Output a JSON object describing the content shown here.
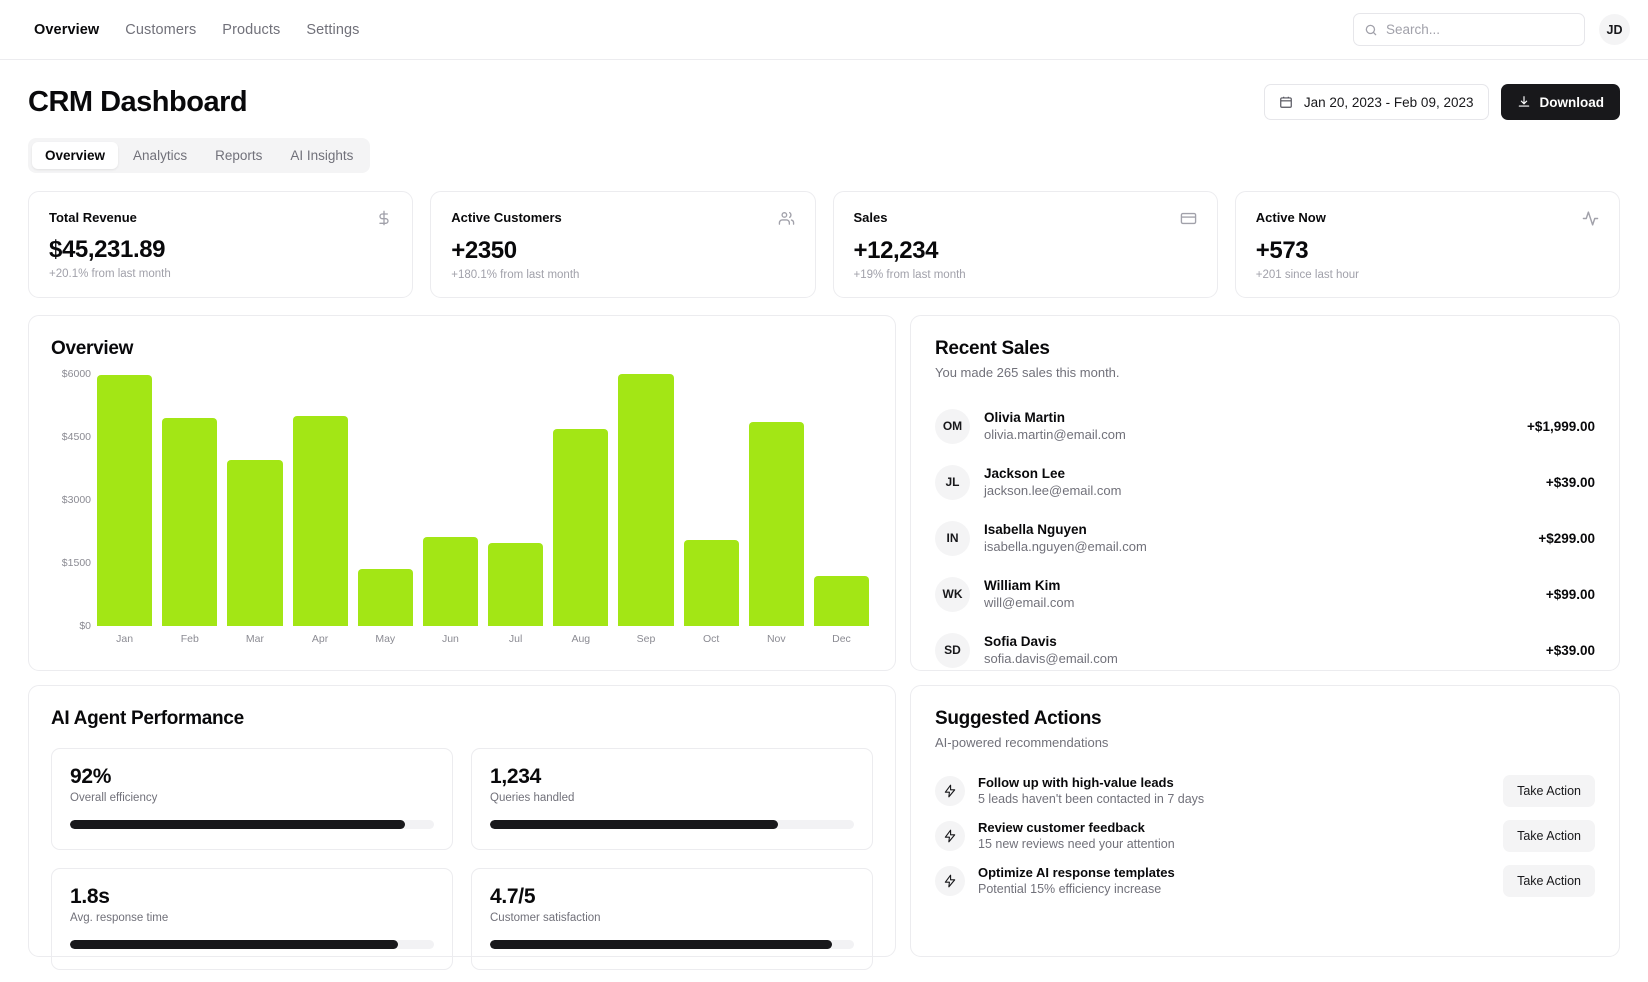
{
  "nav": {
    "links": [
      {
        "label": "Overview",
        "active": true
      },
      {
        "label": "Customers",
        "active": false
      },
      {
        "label": "Products",
        "active": false
      },
      {
        "label": "Settings",
        "active": false
      }
    ],
    "search_placeholder": "Search...",
    "search_value": "",
    "avatar_initials": "JD"
  },
  "header": {
    "title": "CRM Dashboard",
    "date_range": "Jan 20, 2023 - Feb 09, 2023",
    "download_label": "Download"
  },
  "tabs": [
    {
      "label": "Overview",
      "active": true
    },
    {
      "label": "Analytics",
      "active": false
    },
    {
      "label": "Reports",
      "active": false
    },
    {
      "label": "AI Insights",
      "active": false
    }
  ],
  "kpis": [
    {
      "label": "Total Revenue",
      "value": "$45,231.89",
      "sub": "+20.1% from last month",
      "icon": "dollar-icon"
    },
    {
      "label": "Active Customers",
      "value": "+2350",
      "sub": "+180.1% from last month",
      "icon": "users-icon"
    },
    {
      "label": "Sales",
      "value": "+12,234",
      "sub": "+19% from last month",
      "icon": "credit-card-icon"
    },
    {
      "label": "Active Now",
      "value": "+573",
      "sub": "+201 since last hour",
      "icon": "activity-icon"
    }
  ],
  "chart_data": {
    "type": "bar",
    "title": "Overview",
    "categories": [
      "Jan",
      "Feb",
      "Mar",
      "Apr",
      "May",
      "Jun",
      "Jul",
      "Aug",
      "Sep",
      "Oct",
      "Nov",
      "Dec"
    ],
    "values": [
      5970,
      4960,
      3950,
      5010,
      1360,
      2120,
      1970,
      4690,
      6000,
      2050,
      4860,
      1200
    ],
    "ylim": [
      0,
      6000
    ],
    "yticks": [
      0,
      1500,
      3000,
      4500,
      6000
    ],
    "ytick_labels": [
      "$0",
      "$1500",
      "$3000",
      "$4500",
      "$6000"
    ],
    "xlabel": "",
    "ylabel": "",
    "grid": false,
    "legend": false,
    "bar_color": "#a3e615"
  },
  "recent_sales": {
    "title": "Recent Sales",
    "subtitle": "You made 265 sales this month.",
    "items": [
      {
        "initials": "OM",
        "name": "Olivia Martin",
        "email": "olivia.martin@email.com",
        "amount": "+$1,999.00"
      },
      {
        "initials": "JL",
        "name": "Jackson Lee",
        "email": "jackson.lee@email.com",
        "amount": "+$39.00"
      },
      {
        "initials": "IN",
        "name": "Isabella Nguyen",
        "email": "isabella.nguyen@email.com",
        "amount": "+$299.00"
      },
      {
        "initials": "WK",
        "name": "William Kim",
        "email": "will@email.com",
        "amount": "+$99.00"
      },
      {
        "initials": "SD",
        "name": "Sofia Davis",
        "email": "sofia.davis@email.com",
        "amount": "+$39.00"
      }
    ]
  },
  "performance": {
    "title": "AI Agent Performance",
    "metrics": [
      {
        "value": "92%",
        "label": "Overall efficiency",
        "progress": 92
      },
      {
        "value": "1,234",
        "label": "Queries handled",
        "progress": 79
      },
      {
        "value": "1.8s",
        "label": "Avg. response time",
        "progress": 90
      },
      {
        "value": "4.7/5",
        "label": "Customer satisfaction",
        "progress": 94
      }
    ]
  },
  "suggested": {
    "title": "Suggested Actions",
    "subtitle": "AI-powered recommendations",
    "items": [
      {
        "title": "Follow up with high-value leads",
        "desc": "5 leads haven't been contacted in 7 days",
        "button": "Take Action"
      },
      {
        "title": "Review customer feedback",
        "desc": "15 new reviews need your attention",
        "button": "Take Action"
      },
      {
        "title": "Optimize AI response templates",
        "desc": "Potential 15% efficiency increase",
        "button": "Take Action"
      }
    ]
  }
}
